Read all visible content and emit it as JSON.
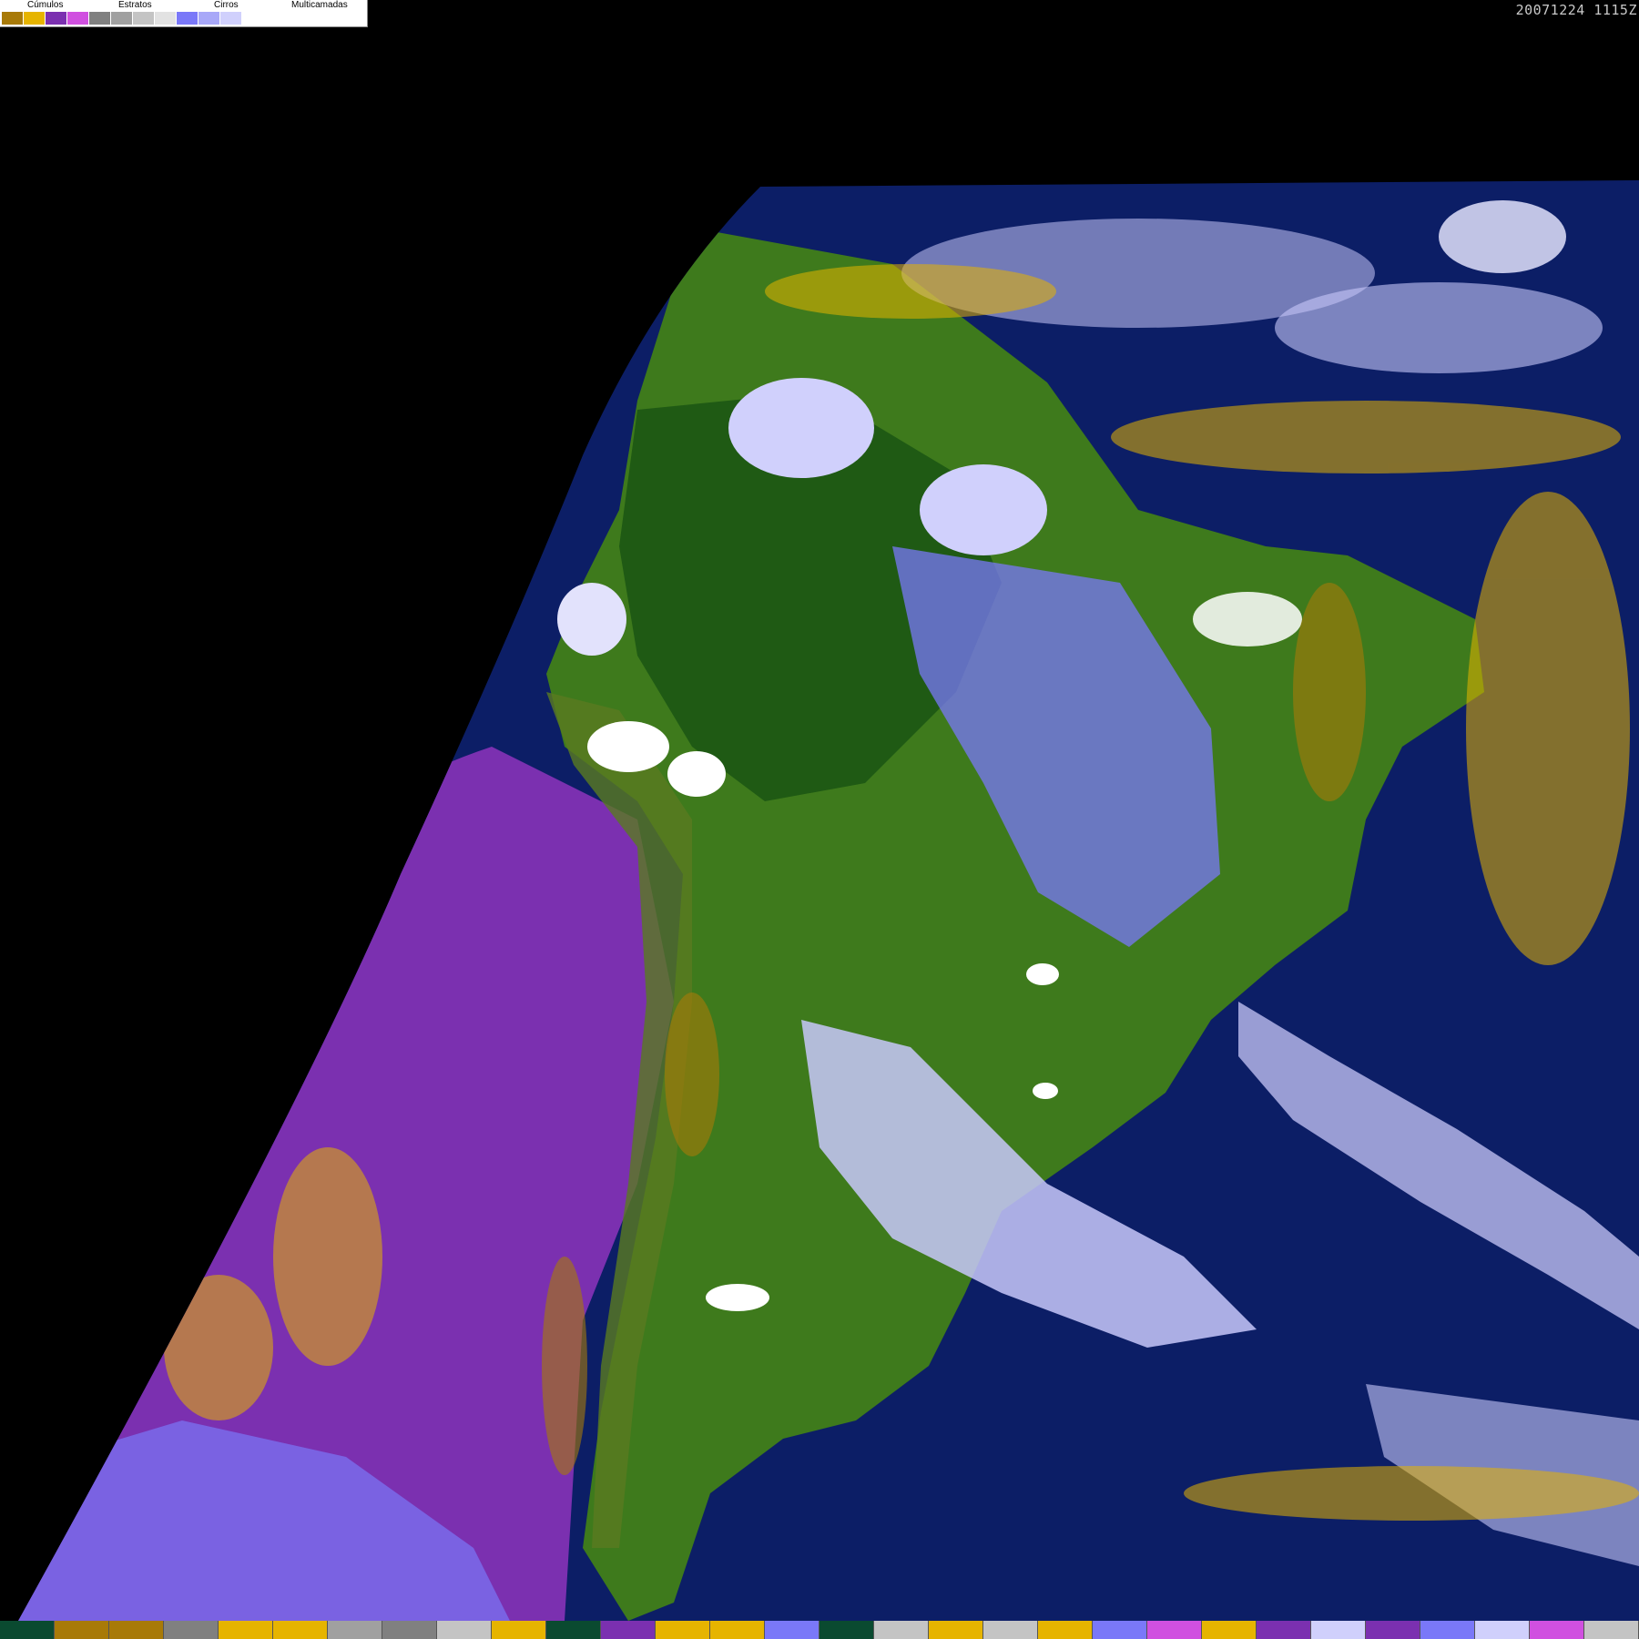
{
  "legend": {
    "groups": [
      {
        "label": "Cúmulos",
        "colors": [
          "#a87a08",
          "#e6b400"
        ]
      },
      {
        "label": "Estratos",
        "colors": [
          "#7b30b0",
          "#d050e0"
        ]
      },
      {
        "label": "Cirros",
        "colors": [
          "#808080",
          "#a0a0a0",
          "#c4c4c4",
          "#e2e2e2"
        ]
      },
      {
        "label": "Multicamadas",
        "colors": [
          "#7a78f8",
          "#a8a8f8",
          "#d0d0fc",
          "#ffffff"
        ]
      }
    ]
  },
  "timestamp": "20071224 1115Z",
  "palette": {
    "space": "#000000",
    "ocean": "#0c1e66",
    "land": "#3e7a1c",
    "forest": "#1f5a14",
    "stratus": "#7b30b0",
    "cumulus_dark": "#a87a08",
    "cumulus_light": "#e6b400",
    "multilayer": "#7a78f8",
    "multilayer_light": "#c8c8fa",
    "cirrus": "#b4b4b4"
  },
  "bottom_bar": [
    "#0a4a30",
    "#a87a08",
    "#a87a08",
    "#808080",
    "#e6b400",
    "#e6b400",
    "#a0a0a0",
    "#808080",
    "#c4c4c4",
    "#e6b400",
    "#0a4a30",
    "#7b30b0",
    "#e6b400",
    "#e6b400",
    "#7a78f8",
    "#0a4a30",
    "#c4c4c4",
    "#e6b400",
    "#c4c4c4",
    "#e6b400",
    "#7a78f8",
    "#d050e0",
    "#e6b400",
    "#7b30b0",
    "#d0d0fc",
    "#7b30b0",
    "#7a78f8",
    "#d0d0fc",
    "#d050e0",
    "#c4c4c4"
  ]
}
